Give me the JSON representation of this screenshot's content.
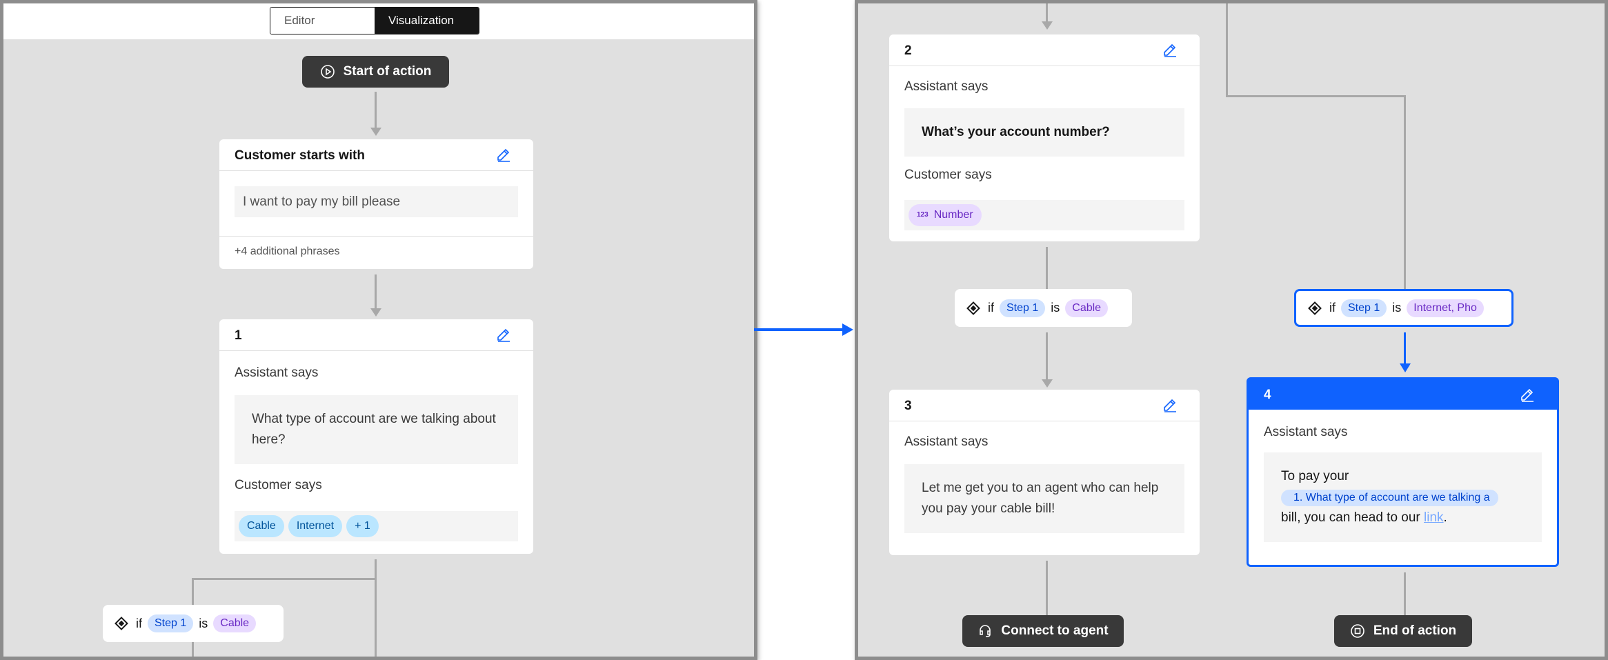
{
  "toolbar": {
    "editor_label": "Editor",
    "visualization_label": "Visualization"
  },
  "start": {
    "label": "Start of action"
  },
  "customer_start": {
    "title": "Customer starts with",
    "phrase": "I want to pay my bill please",
    "additional": "+4 additional phrases"
  },
  "step1": {
    "number": "1",
    "assistant_label": "Assistant says",
    "message": "What type of account are we talking about here?",
    "customer_label": "Customer says",
    "options": [
      "Cable",
      "Internet",
      "+ 1"
    ]
  },
  "condition_left": {
    "if": "if",
    "step": "Step 1",
    "is": "is",
    "value": "Cable"
  },
  "step2": {
    "number": "2",
    "assistant_label": "Assistant says",
    "message": "What’s your account number?",
    "customer_label": "Customer says",
    "response_type": "Number"
  },
  "condition_cable": {
    "if": "if",
    "step": "Step 1",
    "is": "is",
    "value": "Cable"
  },
  "condition_internet": {
    "if": "if",
    "step": "Step 1",
    "is": "is",
    "value": "Internet, Pho"
  },
  "step3": {
    "number": "3",
    "assistant_label": "Assistant says",
    "message": "Let me get you to an agent who can help you pay your cable bill!"
  },
  "step4": {
    "number": "4",
    "assistant_label": "Assistant says",
    "text_before": "To pay your",
    "variable": "1. What type of account are we talking a",
    "text_after": "bill, you can head to our",
    "link": "link",
    "period": "."
  },
  "end_agent": {
    "label": "Connect to agent"
  },
  "end_action": {
    "label": "End of action"
  },
  "colors": {
    "accent": "#0f62fe",
    "pill": "#393939",
    "canvas": "#e0e0e0"
  }
}
